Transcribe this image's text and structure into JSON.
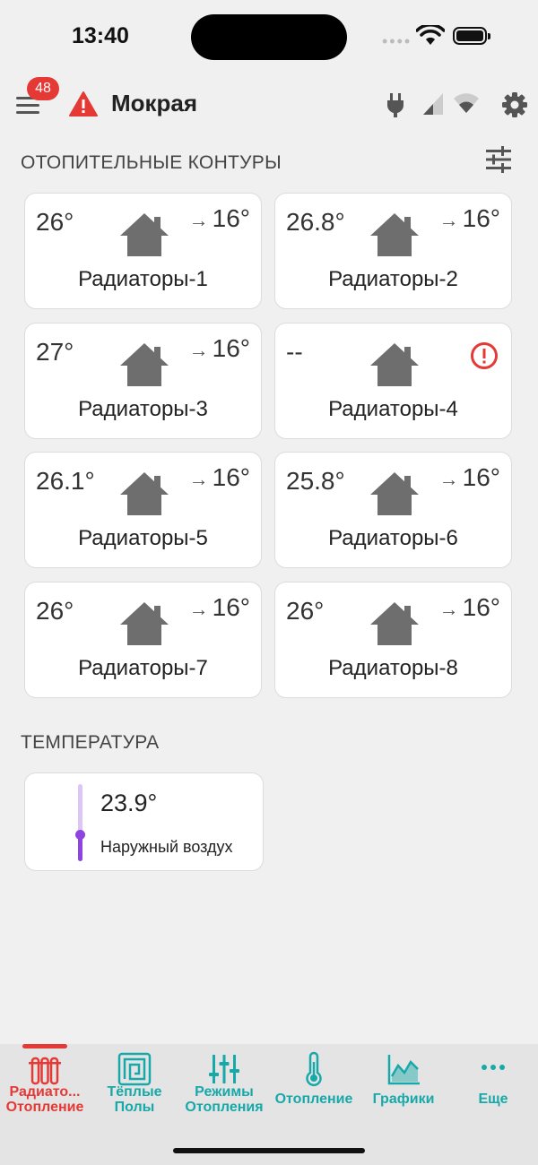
{
  "status": {
    "time": "13:40",
    "dots": "••••"
  },
  "header": {
    "badge_count": "48",
    "title": "Мокрая"
  },
  "sections": {
    "circuits_title": "ОТОПИТЕЛЬНЫЕ КОНТУРЫ",
    "temperature_title": "ТЕМПЕРАТУРА"
  },
  "circuits": [
    {
      "name": "Радиаторы-1",
      "current": "26°",
      "target": "16°"
    },
    {
      "name": "Радиаторы-2",
      "current": "26.8°",
      "target": "16°"
    },
    {
      "name": "Радиаторы-3",
      "current": "27°",
      "target": "16°"
    },
    {
      "name": "Радиаторы-4",
      "current": "--",
      "target": "",
      "alert": true
    },
    {
      "name": "Радиаторы-5",
      "current": "26.1°",
      "target": "16°"
    },
    {
      "name": "Радиаторы-6",
      "current": "25.8°",
      "target": "16°"
    },
    {
      "name": "Радиаторы-7",
      "current": "26°",
      "target": "16°"
    },
    {
      "name": "Радиаторы-8",
      "current": "26°",
      "target": "16°"
    }
  ],
  "arrow": "→",
  "temperature": {
    "value": "23.9°",
    "label": "Наружный воздух",
    "level": 0.35
  },
  "tabs": [
    {
      "line1": "Радиато...",
      "line2": "Отопление",
      "active": true,
      "icon": "radiator-icon"
    },
    {
      "line1": "Тёплые",
      "line2": "Полы",
      "active": false,
      "icon": "floor-heating-icon"
    },
    {
      "line1": "Режимы",
      "line2": "Отопления",
      "active": false,
      "icon": "sliders-icon"
    },
    {
      "line1": "Отопление",
      "line2": "",
      "active": false,
      "icon": "thermometer-icon"
    },
    {
      "line1": "Графики",
      "line2": "",
      "active": false,
      "icon": "chart-icon"
    },
    {
      "line1": "Еще",
      "line2": "",
      "active": false,
      "icon": "more-icon"
    }
  ],
  "colors": {
    "accent_red": "#e53935",
    "teal": "#17a9a9",
    "purple": "#8e44e0",
    "icon_grey": "#6e6e6e"
  }
}
